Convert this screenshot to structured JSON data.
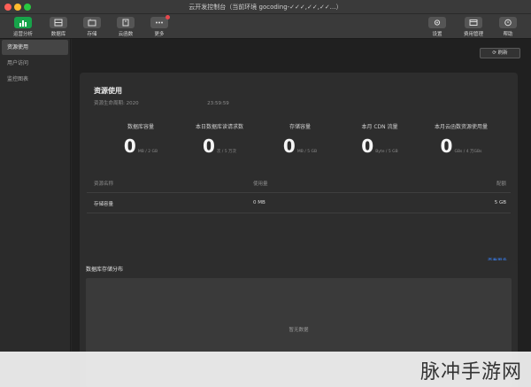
{
  "window": {
    "title": "云开发控制台（当前环境 gocoding-✓✓✓,✓✓,✓✓…）"
  },
  "toolbar": {
    "left": [
      {
        "label": "运营分析",
        "icon": "chart-icon",
        "active": true
      },
      {
        "label": "数据库",
        "icon": "database-icon"
      },
      {
        "label": "存储",
        "icon": "storage-icon"
      },
      {
        "label": "云函数",
        "icon": "function-icon"
      },
      {
        "label": "更多",
        "icon": "more-icon"
      }
    ],
    "right": [
      {
        "label": "设置",
        "icon": "gear-icon"
      },
      {
        "label": "费用管理",
        "icon": "billing-icon"
      },
      {
        "label": "帮助",
        "icon": "help-icon"
      }
    ]
  },
  "sidebar": {
    "items": [
      {
        "label": "资源使用",
        "active": true
      },
      {
        "label": "用户访问"
      },
      {
        "label": "监控图表"
      }
    ]
  },
  "main": {
    "refresh_label": "刷新",
    "usage": {
      "title": "资源使用",
      "period_label": "资源生命周期:",
      "period_start": "2020",
      "period_end": "23:59:59",
      "metrics": [
        {
          "title": "数据库容量",
          "value": "0",
          "unit": "MB / 2 GB"
        },
        {
          "title": "本日数据库读请求数",
          "value": "0",
          "unit": "次 / 5 万次"
        },
        {
          "title": "存储容量",
          "value": "0",
          "unit": "MB / 5 GB"
        },
        {
          "title": "本月 CDN 流量",
          "value": "0",
          "unit": "Byte / 5 GB"
        },
        {
          "title": "本月云函数资源使用量",
          "value": "0",
          "unit": "GBs / 4 万GBs"
        }
      ],
      "table": {
        "headers": [
          "资源名称",
          "使用量",
          "配额"
        ],
        "rows": [
          [
            "存储容量",
            "0 MB",
            "5 GB"
          ]
        ]
      },
      "view_more": "查看更多"
    },
    "db_distribution": {
      "title": "数据库存储分布",
      "empty_text": "暂无数据"
    }
  },
  "watermark": {
    "text": "脉冲手游网"
  }
}
